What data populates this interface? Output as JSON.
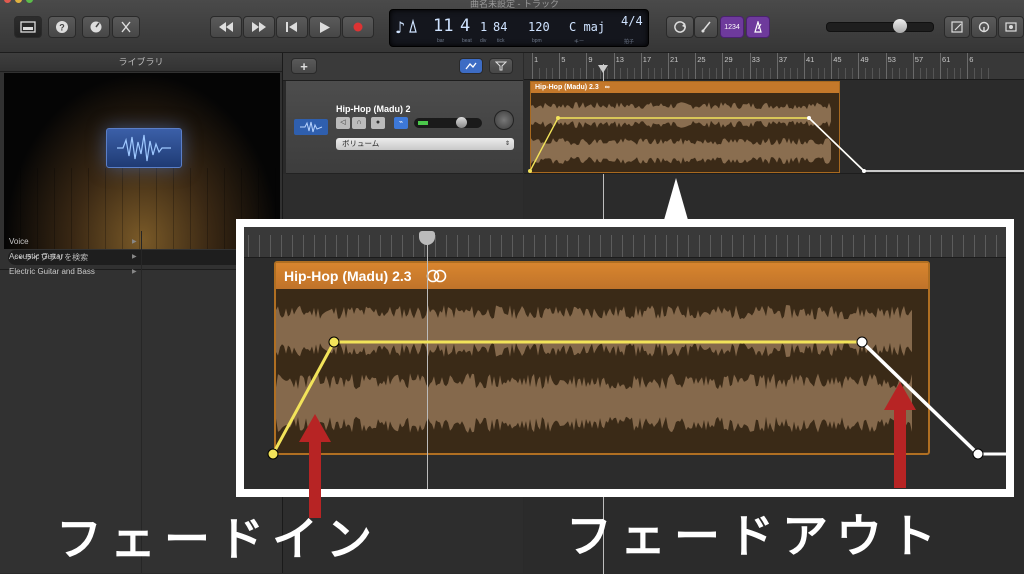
{
  "window": {
    "title": "曲名未設定 - トラック"
  },
  "toolbar": {
    "lcd": {
      "bar": "11",
      "beat": "4",
      "div": "1",
      "tick": "84",
      "bar_label": "bar",
      "beat_label": "beat",
      "div_label": "div",
      "tick_label": "tick",
      "tempo": "120",
      "tempo_label": "bpm",
      "key": "C maj",
      "key_label": "キー",
      "signature": "4/4",
      "signature_label": "拍子"
    },
    "count_in_label": "1234"
  },
  "library": {
    "header": "ライブラリ",
    "search_placeholder": "ライブラリを検索",
    "categories": [
      "Voice",
      "Acoustic Guitar",
      "Electric Guitar and Bass"
    ]
  },
  "track": {
    "name": "Hip-Hop (Madu) 2",
    "automation_param": "ボリューム"
  },
  "ruler": {
    "bars": [
      "1",
      "5",
      "9",
      "13",
      "17",
      "21",
      "25",
      "29",
      "33",
      "37",
      "41",
      "45",
      "49",
      "53",
      "57",
      "61",
      "6"
    ]
  },
  "region": {
    "name": "Hip-Hop (Madu) 2.3"
  },
  "annotations": {
    "fade_in": "フェードイン",
    "fade_out": "フェードアウト"
  },
  "colors": {
    "region_header": "#c4782a",
    "automation_line": "#f2e35a",
    "annotation_arrow": "#b72424",
    "lcd_text": "#cfe3ff"
  }
}
